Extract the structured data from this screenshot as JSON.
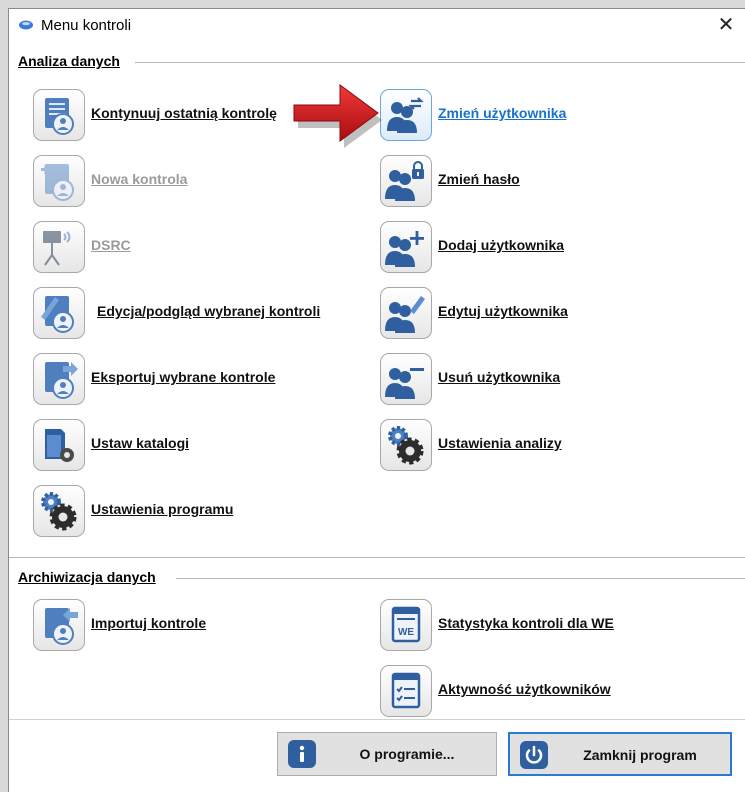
{
  "window": {
    "title": "Menu kontroli",
    "close_symbol": "✕"
  },
  "groups": {
    "analysis": "Analiza danych",
    "archive": "Archiwizacja danych"
  },
  "analysis_left": [
    {
      "label": "Kontynuuj ostatnią kontrolę",
      "icon": "continue-control-icon",
      "enabled": true
    },
    {
      "label": "Nowa kontrola",
      "icon": "new-control-icon",
      "enabled": false
    },
    {
      "label": "DSRC",
      "icon": "dsrc-antenna-icon",
      "enabled": false
    },
    {
      "label": "Edycja/podgląd wybranej kontroli",
      "icon": "edit-control-icon",
      "enabled": true
    },
    {
      "label": "Eksportuj wybrane kontrole",
      "icon": "export-controls-icon",
      "enabled": true
    },
    {
      "label": "Ustaw katalogi",
      "icon": "folder-settings-icon",
      "enabled": true
    },
    {
      "label": "Ustawienia programu",
      "icon": "program-settings-icon",
      "enabled": true
    }
  ],
  "analysis_right": [
    {
      "label": "Zmień użytkownika",
      "icon": "switch-user-icon",
      "enabled": true,
      "hovered": true
    },
    {
      "label": "Zmień hasło",
      "icon": "change-password-icon",
      "enabled": true
    },
    {
      "label": "Dodaj użytkownika",
      "icon": "add-user-icon",
      "enabled": true
    },
    {
      "label": "Edytuj użytkownika",
      "icon": "edit-user-icon",
      "enabled": true
    },
    {
      "label": "Usuń użytkownika",
      "icon": "remove-user-icon",
      "enabled": true
    },
    {
      "label": "Ustawienia analizy",
      "icon": "analysis-settings-icon",
      "enabled": true
    }
  ],
  "archive_left": [
    {
      "label": "Importuj kontrole",
      "icon": "import-controls-icon",
      "enabled": true
    }
  ],
  "archive_right": [
    {
      "label": "Statystyka kontroli dla WE",
      "icon": "we-statistics-icon",
      "badge": "WE",
      "enabled": true
    },
    {
      "label": "Aktywność użytkowników",
      "icon": "user-activity-icon",
      "enabled": true
    }
  ],
  "buttons": {
    "about": "O programie...",
    "close_program": "Zamknij program"
  },
  "colors": {
    "accent": "#2b79d6",
    "icon_blue": "#2f5f9e",
    "arrow_red": "#d8161b",
    "hover_link": "#1a73c8"
  }
}
